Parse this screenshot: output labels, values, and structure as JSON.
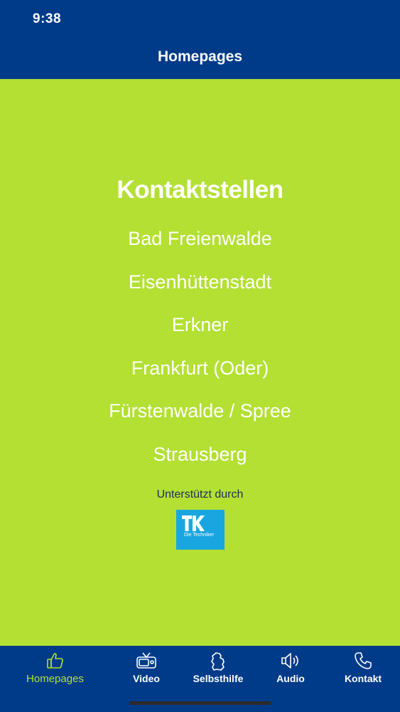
{
  "status_bar": {
    "time": "9:38"
  },
  "header": {
    "title": "Homepages"
  },
  "main": {
    "title": "Kontaktstellen",
    "cities": [
      "Bad Freienwalde",
      "Eisenhüttenstadt",
      "Erkner",
      "Frankfurt (Oder)",
      "Fürstenwalde / Spree",
      "Strausberg"
    ],
    "support_text": "Unterstützt durch",
    "sponsor_logo": {
      "name": "tk-logo",
      "text": "Die Techniker",
      "color": "#19a6e0"
    }
  },
  "tabbar": {
    "tabs": [
      {
        "label": "Homepages",
        "icon": "thumbs-up-icon",
        "active": true
      },
      {
        "label": "Video",
        "icon": "tv-icon",
        "active": false
      },
      {
        "label": "Selbsthilfe",
        "icon": "map-icon",
        "active": false
      },
      {
        "label": "Audio",
        "icon": "speaker-icon",
        "active": false
      },
      {
        "label": "Kontakt",
        "icon": "phone-icon",
        "active": false
      }
    ]
  },
  "colors": {
    "header_bg": "#003b8a",
    "main_bg": "#b3e033",
    "text_white": "#ffffff",
    "active_tab": "#b3e033"
  }
}
